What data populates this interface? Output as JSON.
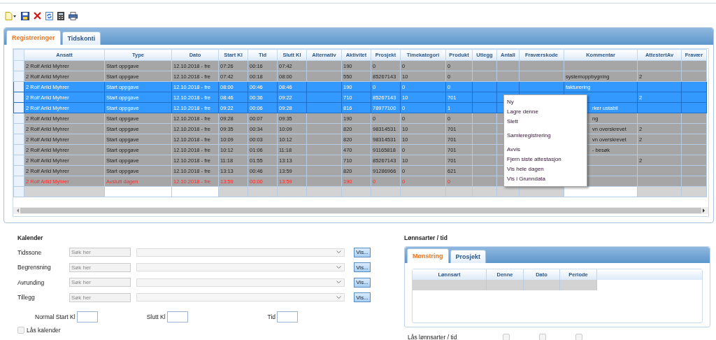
{
  "tabs": [
    {
      "label": "Registreringer",
      "selected": true
    },
    {
      "label": "Tidskonti",
      "selected": false
    }
  ],
  "grid": {
    "columns": [
      {
        "label": "Ansatt",
        "editable": false
      },
      {
        "label": "Type",
        "editable": true
      },
      {
        "label": "Dato",
        "editable": true
      },
      {
        "label": "Start Kl",
        "editable": false
      },
      {
        "label": "Tid",
        "editable": false
      },
      {
        "label": "Slutt Kl",
        "editable": false
      },
      {
        "label": "Alternativ",
        "editable": false
      },
      {
        "label": "Aktivitet",
        "editable": false
      },
      {
        "label": "Prosjekt",
        "editable": false
      },
      {
        "label": "Timekategori",
        "editable": false
      },
      {
        "label": "Produkt",
        "editable": false
      },
      {
        "label": "Utlegg",
        "editable": false
      },
      {
        "label": "Antall",
        "editable": false
      },
      {
        "label": "Fraværskode",
        "editable": false
      },
      {
        "label": "Kommentar",
        "editable": true
      },
      {
        "label": "AttestertAv",
        "editable": false
      },
      {
        "label": "Fravær",
        "editable": false
      }
    ],
    "rows": [
      {
        "kind": "normal",
        "selected": false,
        "cells": [
          "2 Rolf Arild Myhrer",
          "Start oppgave",
          "12.10.2018 - fre",
          "07:26",
          "00:16",
          "07:42",
          null,
          "190",
          "0",
          "0",
          "0",
          null,
          null,
          null,
          null,
          null,
          null
        ]
      },
      {
        "kind": "normal",
        "selected": false,
        "cells": [
          "2 Rolf Arild Myhrer",
          "Start oppgave",
          "12.10.2018 - fre",
          "07:42",
          "00:18",
          "08:00",
          null,
          "550",
          "85267143",
          "10",
          "0",
          null,
          null,
          null,
          "systemoppbygning",
          "2",
          null
        ]
      },
      {
        "kind": "normal",
        "selected": true,
        "cells": [
          "2 Rolf Arild Myhrer",
          "Start oppgave",
          "12.10.2018 - fre",
          "08:00",
          "00:46",
          "08:46",
          null,
          "190",
          "0",
          "0",
          "0",
          null,
          null,
          null,
          "fakturering",
          null,
          null
        ]
      },
      {
        "kind": "normal",
        "selected": true,
        "cells": [
          "2 Rolf Arild Myhrer",
          "Start oppgave",
          "12.10.2018 - fre",
          "08:46",
          "00:36",
          "09:22",
          null,
          "710",
          "85267143",
          "10",
          "701",
          null,
          null,
          null,
          null,
          "2",
          null
        ]
      },
      {
        "kind": "normal",
        "selected": true,
        "under_menu": true,
        "cells": [
          "2 Rolf Arild Myhrer",
          "Start oppgave",
          "12.10.2018 - fre",
          "09:22",
          "00:06",
          "09:28",
          null,
          "816",
          "78977100",
          "0",
          "1",
          null,
          null,
          null,
          "rker ustabil",
          null,
          null
        ]
      },
      {
        "kind": "normal",
        "selected": false,
        "under_menu": true,
        "cells": [
          "2 Rolf Arild Myhrer",
          "Start oppgave",
          "12.10.2018 - fre",
          "09:28",
          "00:07",
          "09:35",
          null,
          "190",
          "0",
          "0",
          "0",
          null,
          null,
          null,
          "ng",
          null,
          null
        ]
      },
      {
        "kind": "normal",
        "selected": false,
        "under_menu": true,
        "cells": [
          "2 Rolf Arild Myhrer",
          "Start oppgave",
          "12.10.2018 - fre",
          "09:35",
          "00:34",
          "10:09",
          null,
          "820",
          "98314531",
          "10",
          "701",
          null,
          null,
          null,
          "vn overskrevet",
          "2",
          null
        ]
      },
      {
        "kind": "normal",
        "selected": false,
        "under_menu": true,
        "cells": [
          "2 Rolf Arild Myhrer",
          "Start oppgave",
          "12.10.2018 - fre",
          "10:09",
          "00:03",
          "10:12",
          null,
          "820",
          "98314531",
          "10",
          "701",
          null,
          null,
          null,
          "vn overskrevet",
          "2",
          null
        ]
      },
      {
        "kind": "normal",
        "selected": false,
        "under_menu": true,
        "cells": [
          "2 Rolf Arild Myhrer",
          "Start oppgave",
          "12.10.2018 - fre",
          "10:12",
          "01:06",
          "11:18",
          null,
          "470",
          "91165818",
          "0",
          "701",
          null,
          null,
          null,
          "- besøk",
          null,
          null
        ]
      },
      {
        "kind": "normal",
        "selected": false,
        "cells": [
          "2 Rolf Arild Myhrer",
          "Start oppgave",
          "12.10.2018 - fre",
          "11:18",
          "01:55",
          "13:13",
          null,
          "710",
          "85267143",
          "10",
          "701",
          null,
          null,
          null,
          null,
          "2",
          null
        ]
      },
      {
        "kind": "normal",
        "selected": false,
        "cells": [
          "2 Rolf Arild Myhrer",
          "Start oppgave",
          "12.10.2018 - fre",
          "13:13",
          "00:46",
          "13:59",
          null,
          "820",
          "91286966",
          "0",
          "621",
          null,
          null,
          null,
          null,
          null,
          null
        ]
      },
      {
        "kind": "ended",
        "selected": false,
        "cells": [
          "2 Rolf Arild Myhrer",
          "Avslutt dagen",
          "12.10.2018 - fre",
          "13:59",
          "00:00",
          "13:59",
          null,
          "190",
          "0",
          "0",
          "0",
          null,
          null,
          null,
          null,
          null,
          null
        ]
      },
      {
        "kind": "new",
        "selected": false,
        "cells": [
          null,
          null,
          null,
          null,
          null,
          null,
          null,
          null,
          null,
          null,
          null,
          null,
          null,
          null,
          null,
          null,
          null
        ]
      }
    ]
  },
  "context_menu": {
    "groups": [
      [
        "Ny",
        "Lagre denne",
        "Slett"
      ],
      [
        "Samleregistrering"
      ],
      [
        "Avvis",
        "Fjern siste attestasjon",
        "Vis hele dagen",
        "Vis i Grunndata"
      ]
    ]
  },
  "kalender": {
    "title": "Kalender",
    "rows": [
      {
        "label": "Tidssone",
        "placeholder": "Søk her",
        "button": "Vis..."
      },
      {
        "label": "Begrensning",
        "placeholder": "Søk her",
        "button": "Vis..."
      },
      {
        "label": "Avrunding",
        "placeholder": "Søk her",
        "button": "Vis..."
      },
      {
        "label": "Tillegg",
        "placeholder": "Søk her",
        "button": "Vis..."
      }
    ],
    "times": [
      {
        "label": "Normal Start Kl"
      },
      {
        "label": "Slutt Kl"
      },
      {
        "label": "Tid"
      }
    ],
    "lock": {
      "label": "Lås kalender",
      "checked": false
    }
  },
  "lonnsarter": {
    "title": "Lønnsarter / tid",
    "tabs": [
      {
        "label": "Mønstring",
        "selected": true
      },
      {
        "label": "Prosjekt",
        "selected": false
      }
    ],
    "columns": [
      "Lønnsart",
      "Denne",
      "Dato",
      "Periode"
    ],
    "lock": {
      "label": "Lås lønnsarter / tid",
      "checks": [
        {
          "checked": false
        },
        {
          "checked": false
        },
        {
          "checked": false
        }
      ]
    }
  }
}
